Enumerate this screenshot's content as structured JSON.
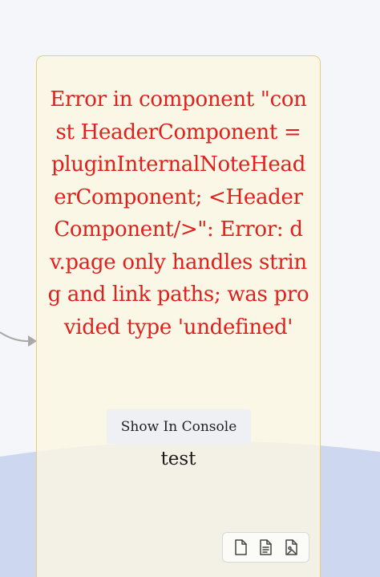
{
  "card": {
    "error_message": "Error in component \"const HeaderComponent = pluginInternalNoteHeaderComponent; <HeaderComponent/>\": Error: dv.page only handles string and link paths; was provided type 'undefined'",
    "console_button_label": "Show In Console",
    "content_text": "test"
  },
  "toolbar": {
    "icons": [
      "file-icon",
      "file-text-icon",
      "file-image-icon"
    ]
  },
  "colors": {
    "error": "#e0201c",
    "card_border": "#e9cd7a",
    "card_bg": "#fbf6e3",
    "background_shape": "#cdd8f0"
  }
}
